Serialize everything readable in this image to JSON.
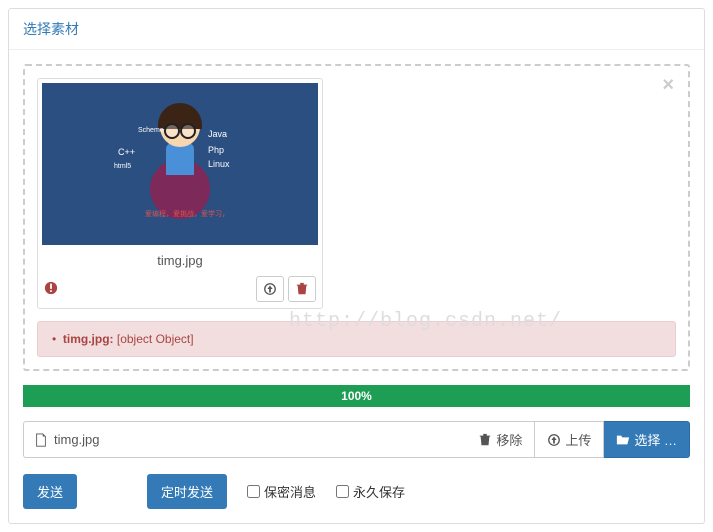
{
  "header": {
    "title": "选择素材"
  },
  "uploadZone": {
    "thumbnail": {
      "filename": "timg.jpg",
      "imageLabels": {
        "java": "Java",
        "cpp": "C++",
        "php": "Php",
        "linux": "Linux",
        "scheme": "Scheme",
        "html5": "html5"
      },
      "redCaption": "爱编程，爱挑战，爱学习，"
    },
    "error": {
      "bullet": "•",
      "file": "timg.jpg:",
      "message": "[object Object]"
    }
  },
  "progress": {
    "label": "100%"
  },
  "fileInput": {
    "filename": "timg.jpg"
  },
  "buttons": {
    "remove": "移除",
    "upload": "上传",
    "select": "选择 …",
    "send": "发送",
    "schedule": "定时发送"
  },
  "checks": {
    "confidential": "保密消息",
    "persist": "永久保存"
  },
  "watermark": "http://blog.csdn.net/"
}
